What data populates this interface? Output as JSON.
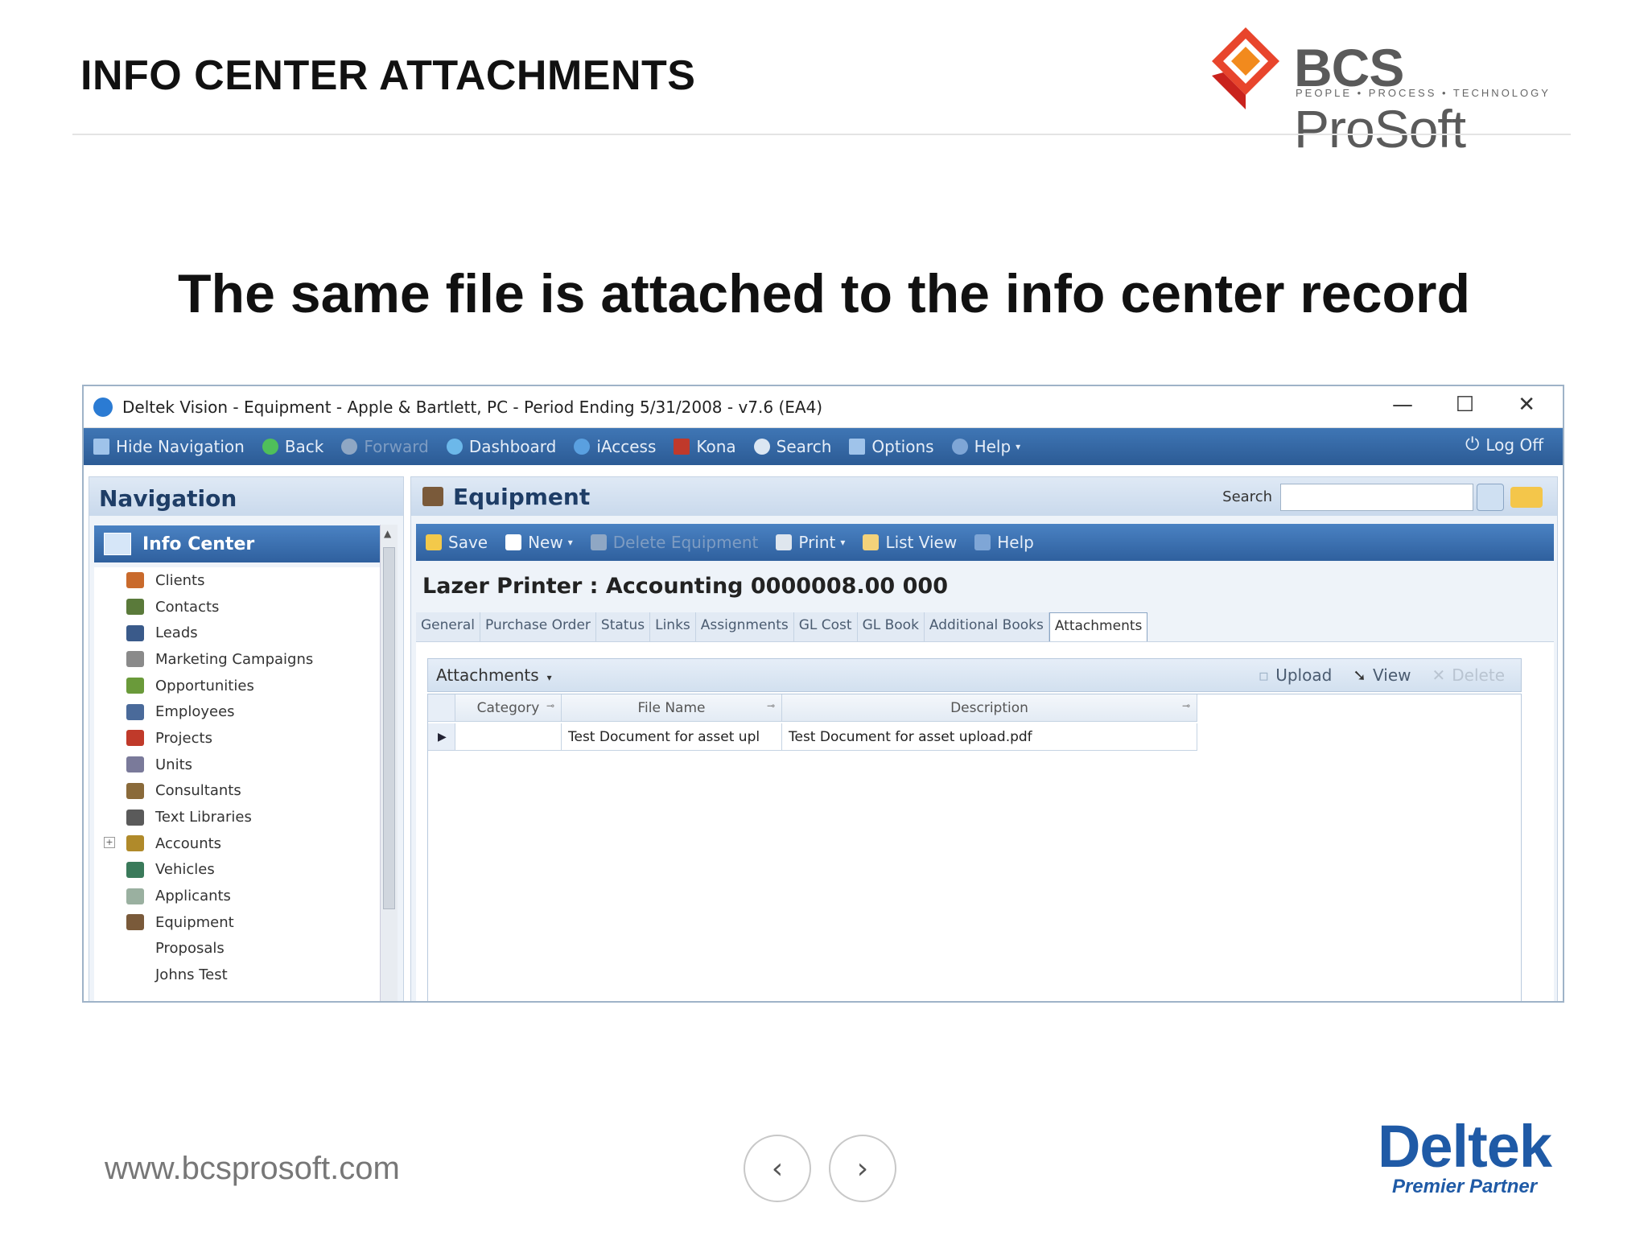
{
  "slide": {
    "title": "INFO CENTER ATTACHMENTS",
    "headline": "The same file is attached to the info center record",
    "logo": {
      "brand_bold": "BCS",
      "brand_rest": " ProSoft",
      "tagline": "PEOPLE • PROCESS • TECHNOLOGY"
    },
    "footer_url": "www.bcsprosoft.com",
    "nav_prev": "‹",
    "nav_next": "›",
    "partner_logo": {
      "name": "Deltek",
      "tag": "Premier Partner",
      "color": "#1f5aa6"
    }
  },
  "window": {
    "title": "Deltek Vision - Equipment - Apple & Bartlett, PC - Period Ending 5/31/2008 - v7.6 (EA4)",
    "minimize": "—",
    "maximize": "☐",
    "close": "✕",
    "toolbar": {
      "hide_navigation": "Hide Navigation",
      "back": "Back",
      "forward": "Forward",
      "dashboard": "Dashboard",
      "iaccess": "iAccess",
      "kona": "Kona",
      "search": "Search",
      "options": "Options",
      "help": "Help",
      "log_off": "Log Off"
    },
    "navigation": {
      "heading": "Navigation",
      "section": "Info Center",
      "items": [
        {
          "label": "Clients",
          "icon": "clients-icon",
          "color": "#c96a2c"
        },
        {
          "label": "Contacts",
          "icon": "contacts-icon",
          "color": "#5a7a3a"
        },
        {
          "label": "Leads",
          "icon": "leads-icon",
          "color": "#3a5a8a"
        },
        {
          "label": "Marketing Campaigns",
          "icon": "campaigns-icon",
          "color": "#8a8a8a"
        },
        {
          "label": "Opportunities",
          "icon": "opportunities-icon",
          "color": "#6a9a3a"
        },
        {
          "label": "Employees",
          "icon": "employees-icon",
          "color": "#4a6a9a"
        },
        {
          "label": "Projects",
          "icon": "projects-icon",
          "color": "#c03a2a"
        },
        {
          "label": "Units",
          "icon": "units-icon",
          "color": "#7a7a9a"
        },
        {
          "label": "Consultants",
          "icon": "consultants-icon",
          "color": "#8a6a3a"
        },
        {
          "label": "Text Libraries",
          "icon": "text-libraries-icon",
          "color": "#5a5a5a"
        },
        {
          "label": "Accounts",
          "icon": "accounts-icon",
          "color": "#b08a2a"
        },
        {
          "label": "Vehicles",
          "icon": "vehicles-icon",
          "color": "#3a7a5a"
        },
        {
          "label": "Applicants",
          "icon": "applicants-icon",
          "color": "#9ab0a0"
        },
        {
          "label": "Equipment",
          "icon": "equipment-icon",
          "color": "#7a5a3a"
        },
        {
          "label": "Proposals",
          "icon": "",
          "color": ""
        },
        {
          "label": "Johns Test",
          "icon": "",
          "color": ""
        }
      ]
    },
    "main": {
      "heading": "Equipment",
      "search_label": "Search",
      "toolbar": {
        "save": "Save",
        "new": "New",
        "delete": "Delete Equipment",
        "print": "Print",
        "list_view": "List View",
        "help": "Help"
      },
      "record_title": "Lazer Printer : Accounting 0000008.00 000",
      "tabs": [
        "General",
        "Purchase Order",
        "Status",
        "Links",
        "Assignments",
        "GL Cost",
        "GL Book",
        "Additional Books",
        "Attachments"
      ],
      "active_tab": "Attachments",
      "attachments": {
        "label": "Attachments",
        "upload": "Upload",
        "view": "View",
        "delete": "Delete",
        "columns": [
          "Category",
          "File Name",
          "Description"
        ],
        "rows": [
          {
            "category": "",
            "file_name": "Test Document for asset upl",
            "description": "Test Document for asset upload.pdf"
          }
        ]
      }
    }
  }
}
